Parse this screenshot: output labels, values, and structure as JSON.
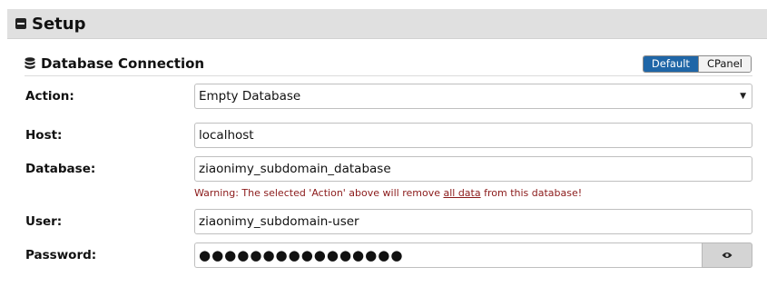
{
  "setup": {
    "title": "Setup"
  },
  "database_connection": {
    "title": "Database Connection",
    "toggle": {
      "default_label": "Default",
      "cpanel_label": "CPanel",
      "selected": "Default"
    }
  },
  "form": {
    "action": {
      "label": "Action:",
      "value": "Empty Database"
    },
    "host": {
      "label": "Host:",
      "value": "localhost"
    },
    "database": {
      "label": "Database:",
      "value": "ziaonimy_subdomain_database"
    },
    "warning": {
      "prefix": "Warning: The selected 'Action' above will remove ",
      "emphasis": "all data",
      "suffix": " from this database!"
    },
    "user": {
      "label": "User:",
      "value": "ziaonimy_subdomain-user"
    },
    "password": {
      "label": "Password:",
      "value": "●●●●●●●●●●●●●●●●",
      "toggle_icon": "eye-icon"
    }
  },
  "colors": {
    "accent": "#1f66a7",
    "warning": "#8b1a1a",
    "header_bg": "#e0e0e0"
  }
}
